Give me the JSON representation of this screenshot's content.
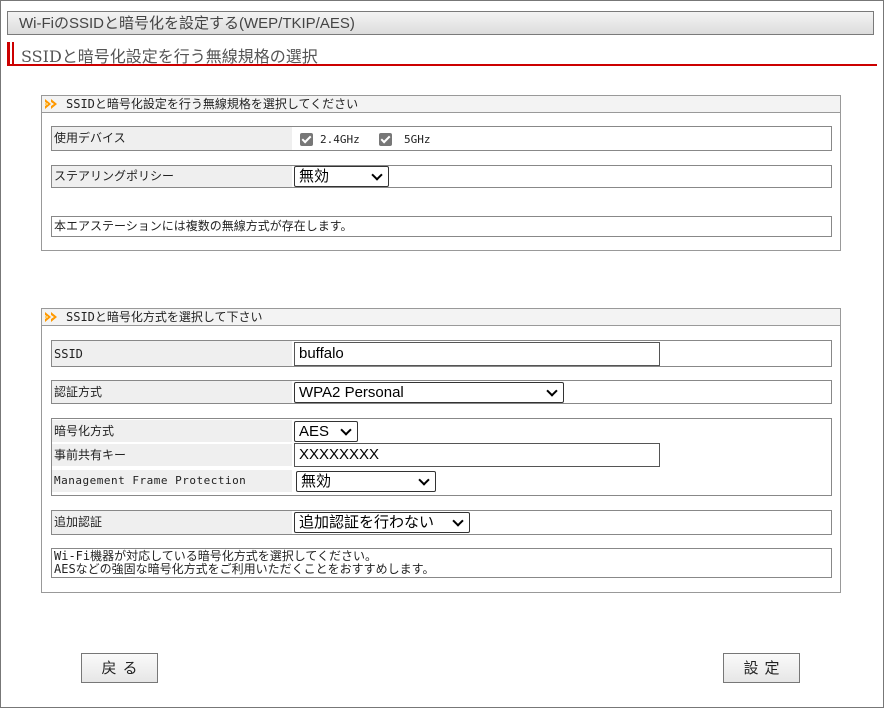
{
  "window_title": "Wi-FiのSSIDと暗号化を設定する(WEP/TKIP/AES)",
  "page_heading": "SSIDと暗号化設定を行う無線規格の選択",
  "section1": {
    "title": "SSIDと暗号化設定を行う無線規格を選択してください",
    "device_label": "使用デバイス",
    "band_24": "2.4GHz",
    "band_5": "5GHz",
    "steering_label": "ステアリングポリシー",
    "steering_value": "無効",
    "note": "本エアステーションには複数の無線方式が存在します。"
  },
  "section2": {
    "title": "SSIDと暗号化方式を選択して下さい",
    "ssid_label": "SSID",
    "ssid_value": "buffalo",
    "auth_label": "認証方式",
    "auth_value": "WPA2 Personal",
    "enc_label": "暗号化方式",
    "enc_value": "AES",
    "psk_label": "事前共有キー",
    "psk_value": "XXXXXXXX",
    "mfp_label": "Management Frame Protection",
    "mfp_value": "無効",
    "addauth_label": "追加認証",
    "addauth_value": "追加認証を行わない",
    "note_line1": "Wi-Fi機器が対応している暗号化方式を選択してください。",
    "note_line2": "AESなどの強固な暗号化方式をご利用いただくことをおすすめします。"
  },
  "buttons": {
    "back": "戻る",
    "save": "設定"
  },
  "colors": {
    "accent": "#cc0000",
    "group_icon": "#ff9900"
  }
}
